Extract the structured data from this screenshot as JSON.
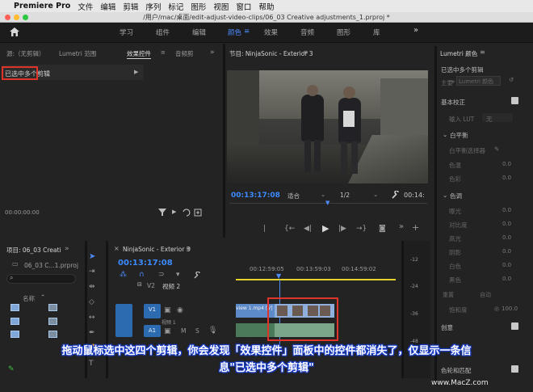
{
  "menubar": {
    "app": "Premiere Pro",
    "items": [
      "文件",
      "编辑",
      "剪辑",
      "序列",
      "标记",
      "图形",
      "视图",
      "窗口",
      "帮助"
    ]
  },
  "titlebar": {
    "path": "/用户/mac/桌面/edit-adjust-video-clips/06_03 Creative adjustments_1.prproj *"
  },
  "workspaces": {
    "tabs": [
      "学习",
      "组件",
      "编辑",
      "颜色",
      "效果",
      "音频",
      "图形",
      "库"
    ],
    "active": "颜色"
  },
  "source_panel": {
    "tabs": [
      "源:（无剪辑）",
      "Lumetri 范围",
      "效果控件",
      "音频剪"
    ],
    "message": "已选中多个剪辑",
    "timecode": "00:00:00:00"
  },
  "program_monitor": {
    "title": "节目: NinjaSonic - Exterior 3",
    "timecode": "00:13:17:08",
    "fit": "适合",
    "resolution": "1/2",
    "end_timecode": "00:14:"
  },
  "project_panel": {
    "title": "项目: 06_03 Creati",
    "file": "06_03 C...1.prproj",
    "column": "名称"
  },
  "timeline": {
    "title": "NinjaSonic - Exterior 3",
    "timecode": "00:13:17:08",
    "ruler": [
      "00:12:59:05",
      "00:13:59:03",
      "00:14:59:02"
    ],
    "tracks": {
      "v2": "视频 2",
      "v1": "V1",
      "a1": "A1"
    },
    "clip_label": "view 1.mp4 [V]",
    "meter": [
      "-12",
      "-24",
      "-36",
      "-48"
    ]
  },
  "lumetri": {
    "title": "Lumetri 颜色",
    "subtitle": "已选中多个剪辑",
    "master": "主要",
    "preset": "Lumetri 颜色",
    "basic": "基本校正",
    "lut_label": "输入 LUT",
    "lut_value": "无",
    "white_balance": "白平衡",
    "wb_picker": "白平衡选择器",
    "temp": "色温",
    "tint": "色彩",
    "tone": "色调",
    "exposure": "曝光",
    "contrast": "对比度",
    "highlights": "高光",
    "shadows": "阴影",
    "whites": "白色",
    "blacks": "黑色",
    "reset": "重置",
    "auto": "自动",
    "saturation": "饱和度",
    "saturation_value": "100.0",
    "creative": "创意",
    "curves": "色轮和匹配",
    "zero": "0.0"
  },
  "caption": {
    "line1": "拖动鼠标选中这四个剪辑，你会发现「效果控件」面板中的控件都消失了，仅显示一条信",
    "line2": "息\"已选中多个剪辑\""
  },
  "watermark": "www.MacZ.com",
  "colors": {
    "accent": "#4d8cff",
    "highlight": "#e0342a",
    "track": "#2d6bb0"
  }
}
